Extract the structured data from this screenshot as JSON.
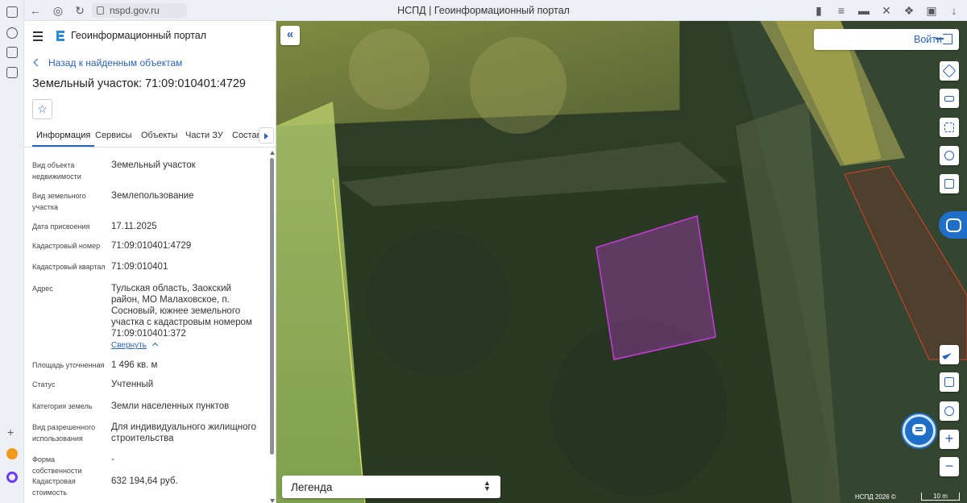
{
  "browser": {
    "url": "nspd.gov.ru",
    "tab_title": "НСПД | Геоинформационный портал"
  },
  "header": {
    "portal_title": "Геоинформационный портал"
  },
  "object": {
    "back_label": "Назад к найденным объектам",
    "title": "Земельный участок: 71:09:010401:4729"
  },
  "tabs": [
    "Информация",
    "Сервисы",
    "Объекты",
    "Части ЗУ",
    "Состав"
  ],
  "info": [
    {
      "label": "Вид объекта недвижимости",
      "value": "Земельный участок"
    },
    {
      "label": "Вид земельного участка",
      "value": "Землепользование"
    },
    {
      "label": "Дата присвоения",
      "value": "17.11.2025"
    },
    {
      "label": "Кадастровый номер",
      "value": "71:09:010401:4729"
    },
    {
      "label": "Кадастровый квартал",
      "value": "71:09:010401"
    },
    {
      "label": "Адрес",
      "value": "Тульская область, Заокский район, МО Малаховское, п. Сосновый, южнее земельного участка с кадастровым номером 71:09:010401:372"
    },
    {
      "label": "Площадь уточненная",
      "value": "1 496 кв. м"
    },
    {
      "label": "Статус",
      "value": "Учтенный"
    },
    {
      "label": "Категория земель",
      "value": "Земли населенных пунктов"
    },
    {
      "label": "Вид разрешенного использования",
      "value": "Для индивидуального жилищного строительства"
    },
    {
      "label": "Форма собственности",
      "value": "-"
    },
    {
      "label": "Кадастровая стоимость",
      "value": "632 194,64 руб."
    }
  ],
  "collapse_label": "Свернуть",
  "map": {
    "login_label": "Войти",
    "legend_label": "Легенда",
    "copyright": "НСПД 2026 ©",
    "scale_label": "10 m",
    "zoom_in": "+",
    "zoom_out": "−",
    "parcel_color": "#c23bd6",
    "neighbor_color": "#e8e35a"
  },
  "colors": {
    "accent": "#2a63b8",
    "fab": "#1f6fc8"
  }
}
